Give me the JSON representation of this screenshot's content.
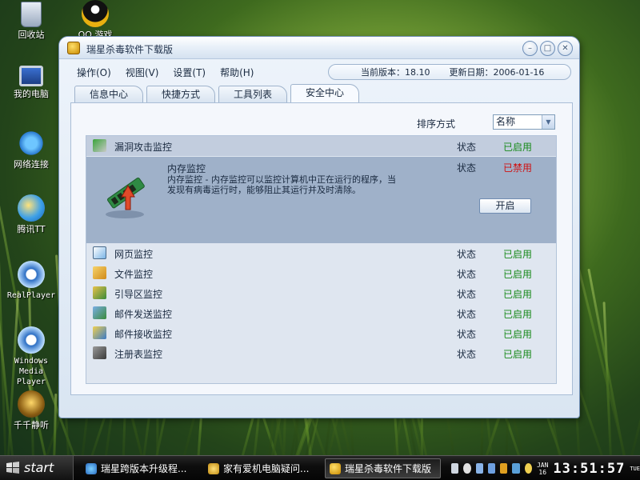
{
  "desktop": {
    "icons": [
      {
        "label": "回收站"
      },
      {
        "label": "QQ 游戏"
      },
      {
        "label": "我的电脑"
      },
      {
        "label": "网络连接"
      },
      {
        "label": "腾讯TT"
      },
      {
        "label": "RealPlayer"
      },
      {
        "label": "Windows Media Player"
      },
      {
        "label": "千千静听"
      }
    ]
  },
  "window": {
    "title": "瑞星杀毒软件下载版",
    "menus": [
      "操作(O)",
      "视图(V)",
      "设置(T)",
      "帮助(H)"
    ],
    "version_label": "当前版本：18.10",
    "date_label": "更新日期：2006-01-16",
    "tabs": [
      "信息中心",
      "快捷方式",
      "工具列表",
      "安全中心"
    ],
    "active_tab": "安全中心",
    "sort_label": "排序方式",
    "sort_value": "名称",
    "rows": [
      {
        "name": "漏洞攻击监控",
        "state": "状态",
        "status": "已启用",
        "icon": "vuln-shield-icon"
      },
      {
        "name": "网页监控",
        "state": "状态",
        "status": "已启用",
        "icon": "webpage-icon"
      },
      {
        "name": "文件监控",
        "state": "状态",
        "status": "已启用",
        "icon": "file-icon"
      },
      {
        "name": "引导区监控",
        "state": "状态",
        "status": "已启用",
        "icon": "boot-sector-icon"
      },
      {
        "name": "邮件发送监控",
        "state": "状态",
        "status": "已启用",
        "icon": "mail-send-icon"
      },
      {
        "name": "邮件接收监控",
        "state": "状态",
        "status": "已启用",
        "icon": "mail-receive-icon"
      },
      {
        "name": "注册表监控",
        "state": "状态",
        "status": "已启用",
        "icon": "registry-icon"
      }
    ],
    "expanded": {
      "name": "内存监控",
      "state": "状态",
      "status": "已禁用",
      "description": "内存监控 - 内存监控可以监控计算机中正在运行的程序，当发现有病毒运行时，能够阻止其运行并及时清除。",
      "button": "开启"
    }
  },
  "taskbar": {
    "start": "start",
    "tasks": [
      {
        "label": "瑞星跨版本升级程..."
      },
      {
        "label": "家有爱机电脑疑问..."
      },
      {
        "label": "瑞星杀毒软件下载版"
      }
    ],
    "date_top": "JAN",
    "date_bottom": "16",
    "clock": "13:51:57",
    "day": "TUE"
  },
  "colors": {
    "enabled": "#188a1a",
    "disabled": "#d01010",
    "expanded_bg": "#9fb1c9"
  }
}
